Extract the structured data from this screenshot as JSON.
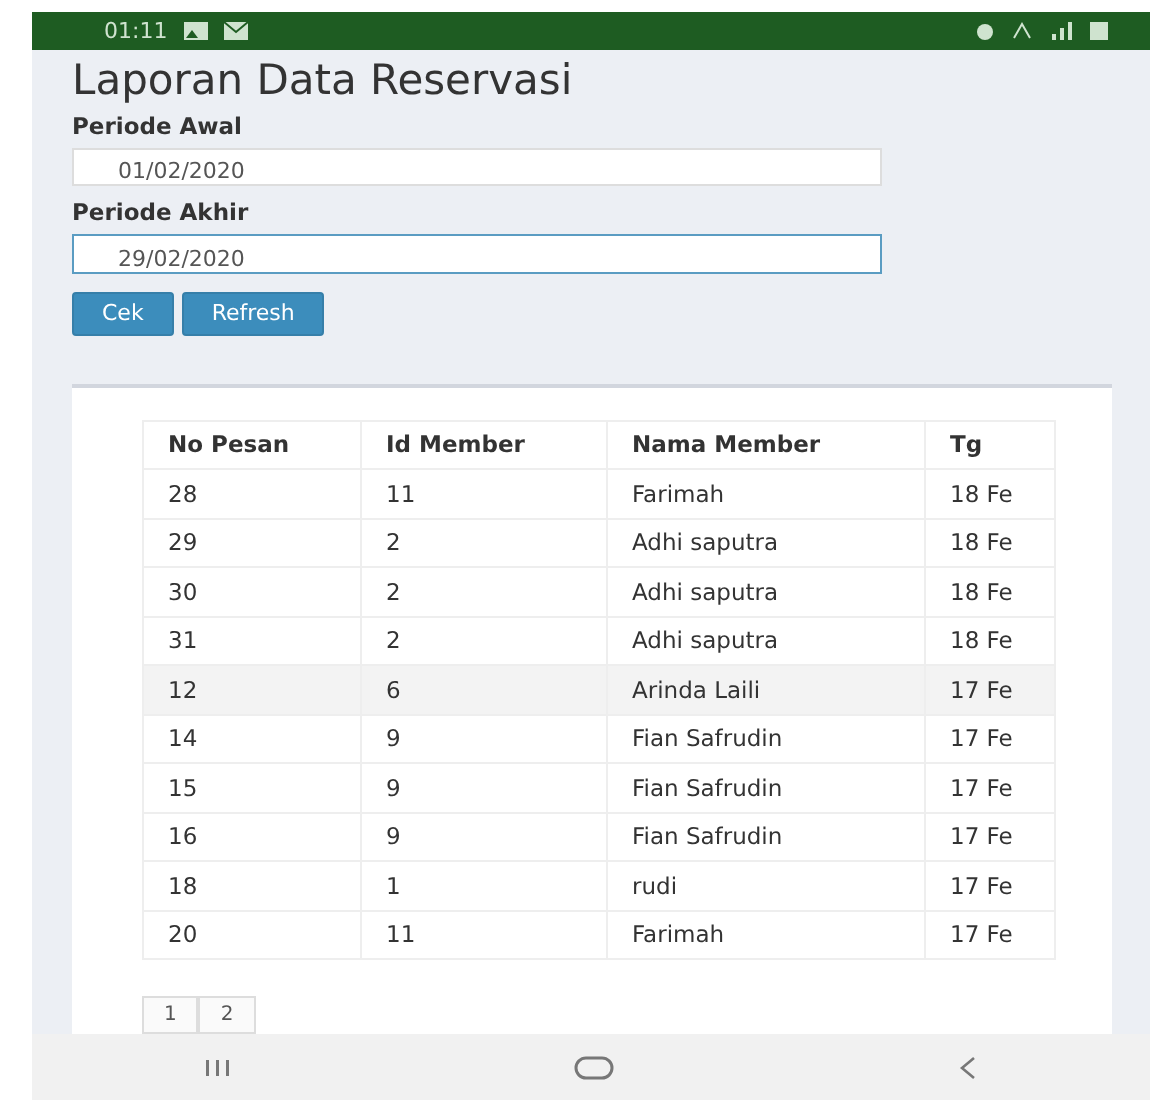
{
  "status_bar": {
    "time": "01:11"
  },
  "title": "Laporan Data Reservasi",
  "fields": [
    {
      "label": "Periode Awal",
      "value": "01/02/2020",
      "focused": false
    },
    {
      "label": "Periode Akhir",
      "value": "29/02/2020",
      "focused": true
    }
  ],
  "buttons": [
    "Cek",
    "Refresh"
  ],
  "table": {
    "columns": [
      "No Pesan",
      "Id Member",
      "Nama Member",
      "Tg"
    ],
    "rows": [
      {
        "cells": [
          "28",
          "11",
          "Farimah",
          "18 Fe"
        ],
        "highlighted": false
      },
      {
        "cells": [
          "29",
          "2",
          "Adhi saputra",
          "18 Fe"
        ],
        "highlighted": false
      },
      {
        "cells": [
          "30",
          "2",
          "Adhi saputra",
          "18 Fe"
        ],
        "highlighted": false
      },
      {
        "cells": [
          "31",
          "2",
          "Adhi saputra",
          "18 Fe"
        ],
        "highlighted": false
      },
      {
        "cells": [
          "12",
          "6",
          "Arinda Laili",
          "17 Fe"
        ],
        "highlighted": true
      },
      {
        "cells": [
          "14",
          "9",
          "Fian Safrudin",
          "17 Fe"
        ],
        "highlighted": false
      },
      {
        "cells": [
          "15",
          "9",
          "Fian Safrudin",
          "17 Fe"
        ],
        "highlighted": false
      },
      {
        "cells": [
          "16",
          "9",
          "Fian Safrudin",
          "17 Fe"
        ],
        "highlighted": false
      },
      {
        "cells": [
          "18",
          "1",
          "rudi",
          "17 Fe"
        ],
        "highlighted": false
      },
      {
        "cells": [
          "20",
          "11",
          "Farimah",
          "17 Fe"
        ],
        "highlighted": false
      }
    ]
  },
  "pagination": [
    "1",
    "2"
  ]
}
